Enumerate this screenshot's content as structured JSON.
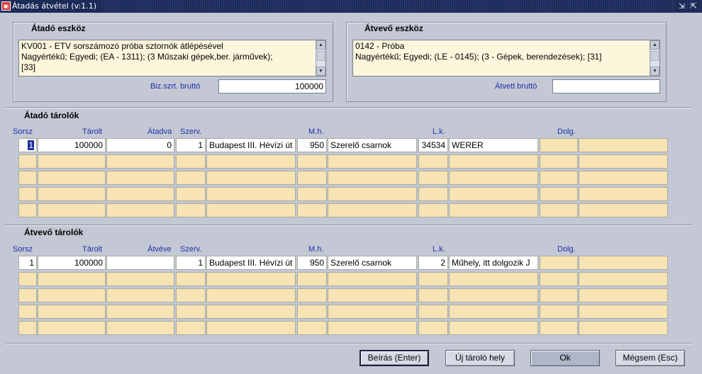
{
  "window": {
    "title": "Átadás átvétel (v:1.1)",
    "app_icon": "app-icon",
    "controls": [
      "restore-icon",
      "maximize-icon"
    ]
  },
  "atado_eszkoz": {
    "label": "Átadó eszköz",
    "lines": [
      "KV001 - ETV sorszámozó próba sztornók átlépésével",
      "Nagyértékű; Egyedi; (EA - 1311); (3 Műszaki gépek,ber. járművek);",
      "[33]"
    ],
    "brutto_label": "Biz.szrt. bruttó",
    "brutto_value": "100000"
  },
  "atvevo_eszkoz": {
    "label": "Átvevő eszköz",
    "lines": [
      "0142 - Próba",
      "Nagyértékű; Egyedi; (LE - 0145); (3 - Gépek, berendezések); [31]"
    ],
    "brutto_label": "Átvett bruttó",
    "brutto_value": ""
  },
  "atado_tarolok": {
    "label": "Átadó tárolók",
    "headers": [
      "Sorsz",
      "Tárolt",
      "Átadva",
      "Szerv.",
      "M.h.",
      "L.k.",
      "Dolg."
    ],
    "row1": [
      "1",
      "100000",
      "0",
      "1",
      "Budapest III. Hévízi út",
      "950",
      "Szerelő csarnok",
      "34534",
      "WERER",
      "",
      ""
    ]
  },
  "atvevo_tarolok": {
    "label": "Átvevő tárolók",
    "headers": [
      "Sorsz",
      "Tárolt",
      "Átvéve",
      "Szerv.",
      "M.h.",
      "L.k.",
      "Dolg."
    ],
    "row1": [
      "1",
      "100000",
      "",
      "1",
      "Budapest III. Hévízi út",
      "950",
      "Szerelő csarnok",
      "2",
      "Műhely, itt dolgozik J",
      "",
      ""
    ]
  },
  "buttons": {
    "beiras": "Beírás (Enter)",
    "uj_tarolo": "Új tároló hely",
    "ok": "Ok",
    "megsem": "Mégsem (Esc)"
  }
}
